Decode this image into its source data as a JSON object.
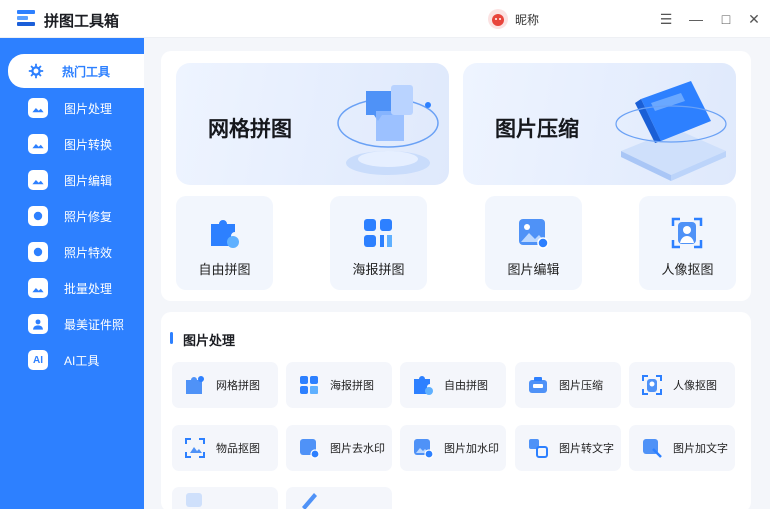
{
  "app": {
    "title": "拼图工具箱"
  },
  "user": {
    "nickname": "昵称"
  },
  "window_controls": {
    "menu": "☰",
    "minimize": "—",
    "maximize": "□",
    "close": "✕"
  },
  "sidebar": {
    "items": [
      {
        "label": "热门工具",
        "icon": "hot-tools-icon",
        "active": true
      },
      {
        "label": "图片处理",
        "icon": "image-process-icon"
      },
      {
        "label": "图片转换",
        "icon": "image-convert-icon"
      },
      {
        "label": "图片编辑",
        "icon": "image-edit-icon"
      },
      {
        "label": "照片修复",
        "icon": "photo-repair-icon"
      },
      {
        "label": "照片特效",
        "icon": "photo-effect-icon"
      },
      {
        "label": "批量处理",
        "icon": "batch-icon"
      },
      {
        "label": "最美证件照",
        "icon": "id-photo-icon"
      },
      {
        "label": "AI工具",
        "icon": "ai-icon"
      }
    ]
  },
  "hot": {
    "big": [
      {
        "label": "网格拼图",
        "icon": "grid-collage-illustration"
      },
      {
        "label": "图片压缩",
        "icon": "compress-illustration"
      }
    ],
    "small": [
      {
        "label": "自由拼图",
        "icon": "puzzle-icon"
      },
      {
        "label": "海报拼图",
        "icon": "poster-icon"
      },
      {
        "label": "图片编辑",
        "icon": "image-edit-icon"
      },
      {
        "label": "人像抠图",
        "icon": "portrait-icon"
      }
    ]
  },
  "image_processing": {
    "title": "图片处理",
    "tools": [
      {
        "label": "网格拼图",
        "icon": "grid-collage-icon"
      },
      {
        "label": "海报拼图",
        "icon": "poster-icon"
      },
      {
        "label": "自由拼图",
        "icon": "puzzle-icon"
      },
      {
        "label": "图片压缩",
        "icon": "compress-icon"
      },
      {
        "label": "人像抠图",
        "icon": "portrait-icon"
      },
      {
        "label": "物品抠图",
        "icon": "object-cutout-icon"
      },
      {
        "label": "图片去水印",
        "icon": "remove-watermark-icon"
      },
      {
        "label": "图片加水印",
        "icon": "add-watermark-icon"
      },
      {
        "label": "图片转文字",
        "icon": "image-to-text-icon"
      },
      {
        "label": "图片加文字",
        "icon": "add-text-icon"
      }
    ]
  },
  "colors": {
    "accent": "#2d80ff",
    "sidebar_bg": "#2d80ff",
    "card_bg": "#f4f6fb"
  }
}
